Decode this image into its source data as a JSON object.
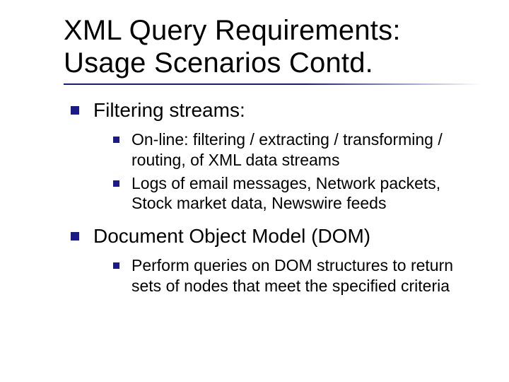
{
  "title": "XML Query Requirements: Usage Scenarios Contd.",
  "items": [
    {
      "label": "Filtering streams:",
      "children": [
        {
          "label": "On-line: filtering / extracting / transforming / routing, of XML data streams"
        },
        {
          "label": "Logs of email messages, Network packets, Stock market data, Newswire feeds"
        }
      ]
    },
    {
      "label": "Document Object Model (DOM)",
      "children": [
        {
          "label": "Perform queries on DOM structures to return sets of nodes that meet the specified criteria"
        }
      ]
    }
  ]
}
